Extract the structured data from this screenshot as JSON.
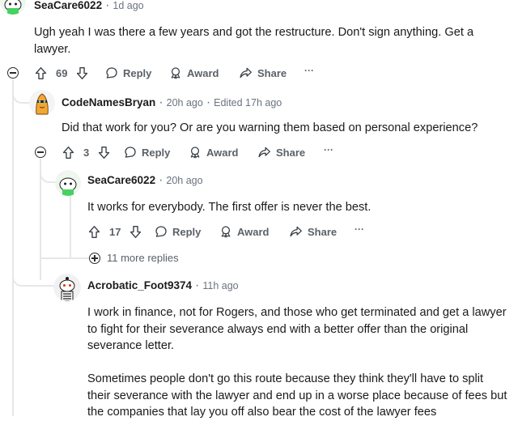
{
  "comments": [
    {
      "username": "SeaCare6022",
      "time": "1d ago",
      "body": [
        "Ugh yeah I was there a few years and got the restructure. Don't sign anything. Get a",
        "lawyer."
      ],
      "votes": "69",
      "reply": "Reply",
      "award": "Award",
      "share": "Share",
      "more": "···"
    },
    {
      "username": "CodeNamesBryan",
      "time": "20h ago",
      "edited": "Edited 17h ago",
      "body": [
        "Did that work for you? Or are you warning them based on personal experience?"
      ],
      "votes": "3",
      "reply": "Reply",
      "award": "Award",
      "share": "Share",
      "more": "···"
    },
    {
      "username": "SeaCare6022",
      "time": "20h ago",
      "body": [
        "It works for everybody. The first offer is never the best."
      ],
      "votes": "17",
      "reply": "Reply",
      "award": "Award",
      "share": "Share",
      "more": "···",
      "more_replies": "11 more replies"
    },
    {
      "username": "Acrobatic_Foot9374",
      "time": "11h ago",
      "body": [
        "I work in finance, not for Rogers, and those who get terminated and get a lawyer",
        "to fight for their severance always end with a better offer than the original",
        "severance letter.",
        "",
        "Sometimes people don't go this route because they think they'll have to split",
        "their severance with the lawyer and end up in a worse place because of fees but",
        "the companies that lay you off also bear the cost of the lawyer fees"
      ]
    }
  ],
  "colors": {
    "accent_green": "#46d160",
    "text": "#1a1a1b",
    "muted": "#6b7280",
    "thread": "#e5e7ea"
  }
}
